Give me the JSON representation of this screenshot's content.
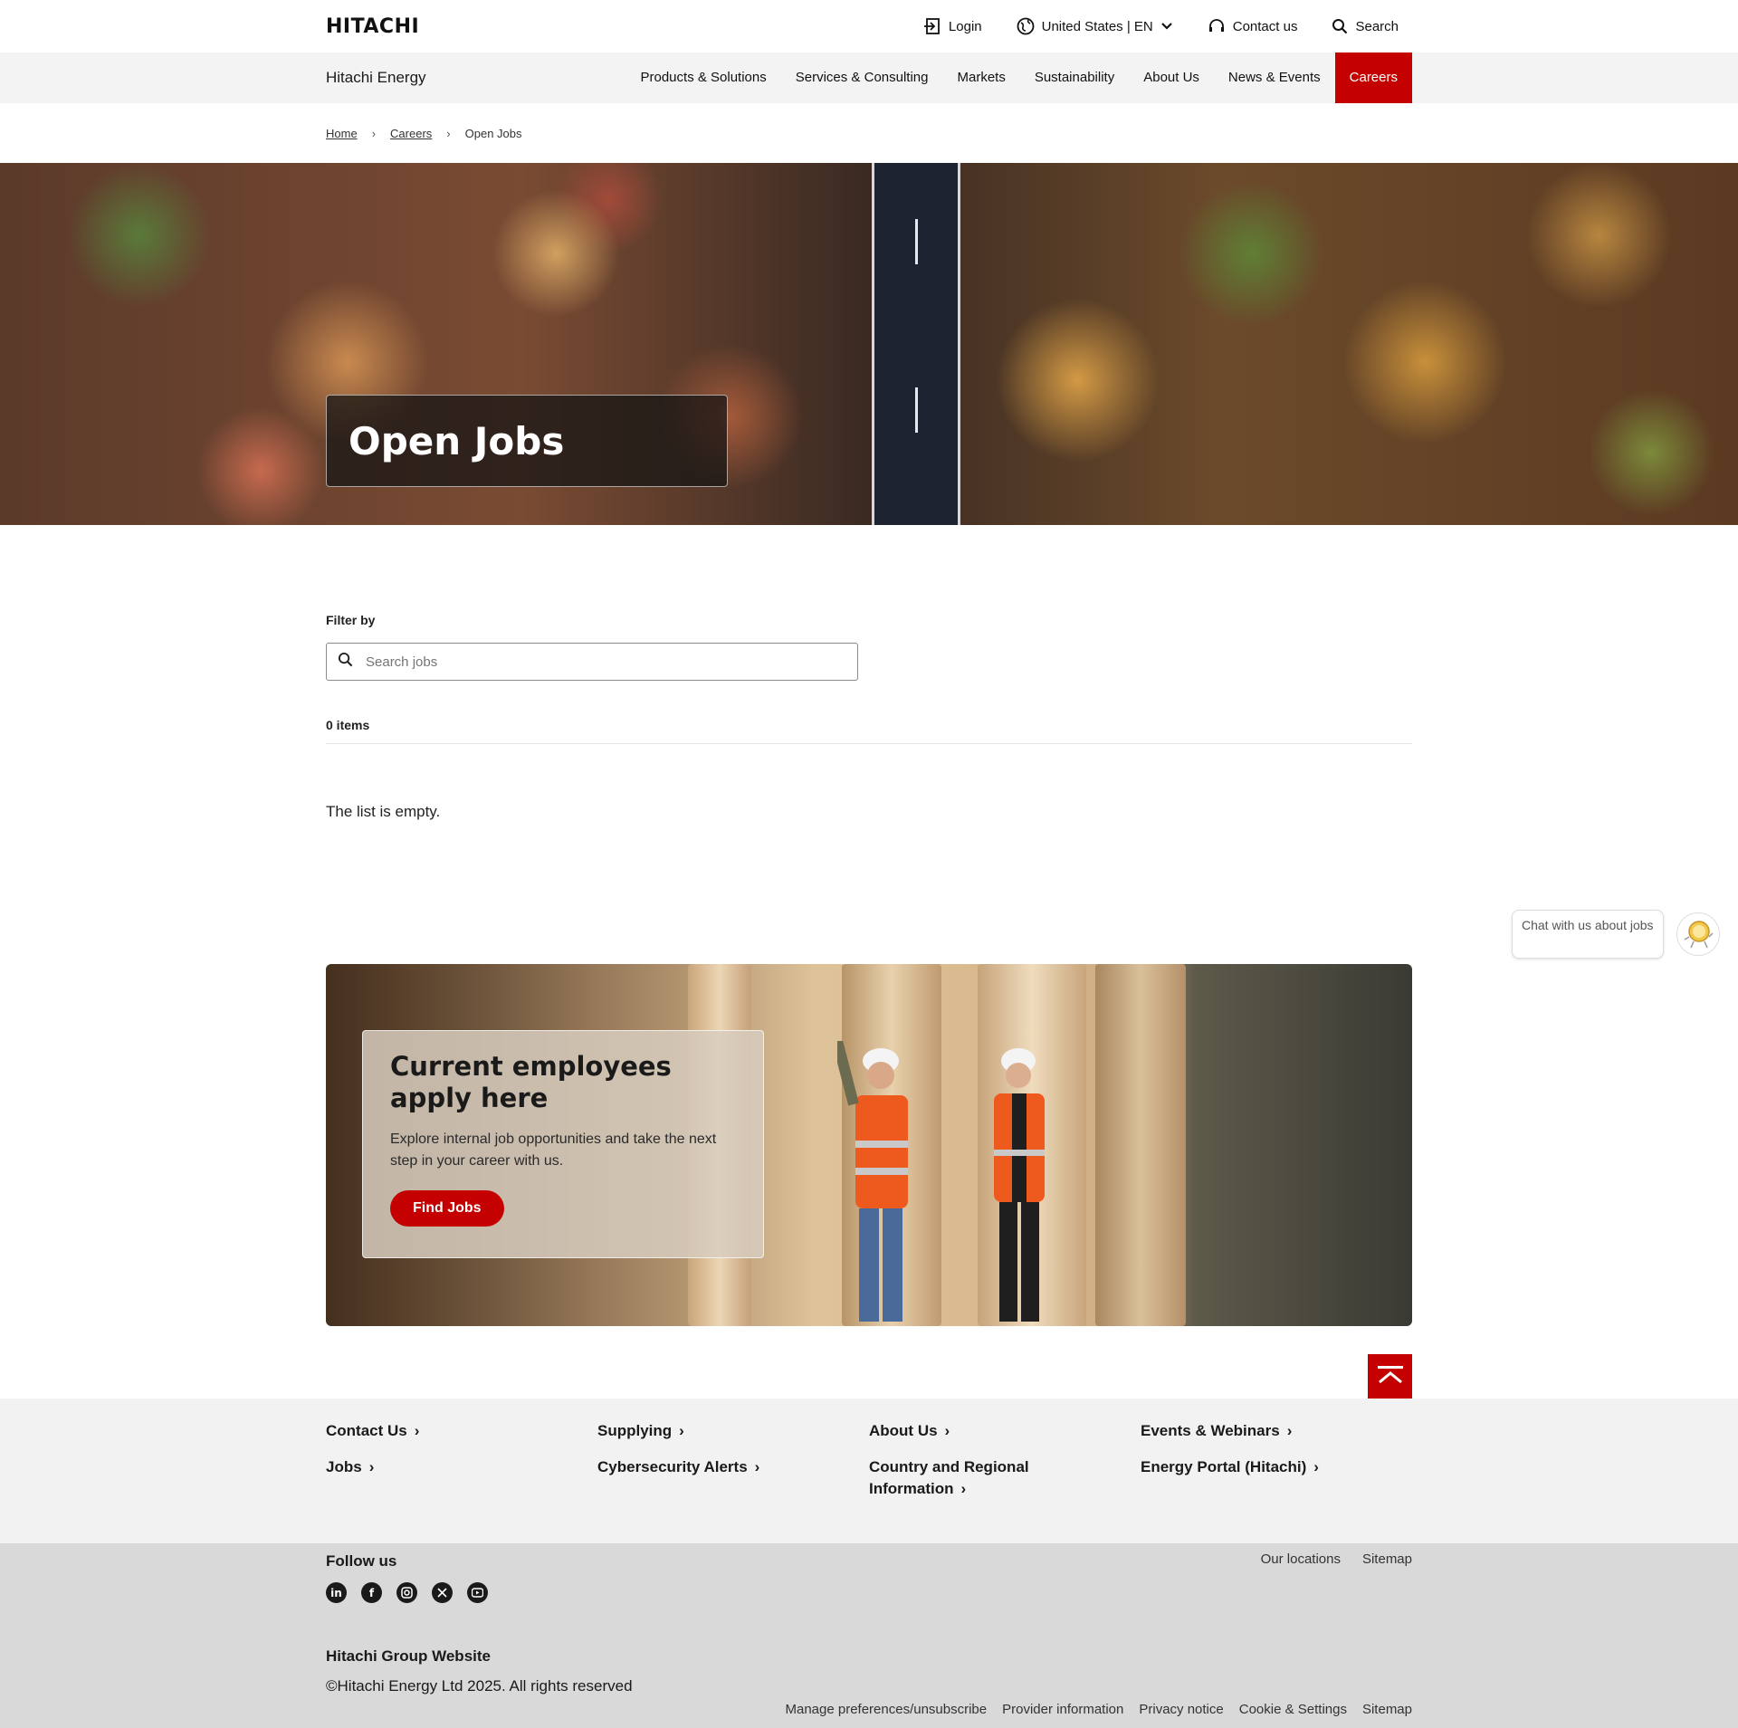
{
  "header": {
    "logo": "HITACHI",
    "login": "Login",
    "region": "United States | EN",
    "contact": "Contact us",
    "search": "Search"
  },
  "nav": {
    "brand": "Hitachi Energy",
    "items": [
      {
        "label": "Products & Solutions"
      },
      {
        "label": "Services & Consulting"
      },
      {
        "label": "Markets"
      },
      {
        "label": "Sustainability"
      },
      {
        "label": "About Us"
      },
      {
        "label": "News & Events"
      },
      {
        "label": "Careers"
      }
    ]
  },
  "breadcrumb": {
    "home": "Home",
    "careers": "Careers",
    "current": "Open Jobs"
  },
  "hero": {
    "title": "Open Jobs"
  },
  "filter": {
    "label": "Filter by",
    "search_placeholder": "Search jobs",
    "count": "0 items",
    "empty": "The list is empty."
  },
  "chat": {
    "text": "Chat with us about jobs"
  },
  "promo": {
    "title": "Current employees apply here",
    "text": "Explore internal job opportunities and take the next step in your career with us.",
    "button": "Find Jobs"
  },
  "footer_links": {
    "col1": [
      "Contact Us",
      "Jobs"
    ],
    "col2": [
      "Supplying",
      "Cybersecurity Alerts"
    ],
    "col3": [
      "About Us",
      "Country and Regional Information"
    ],
    "col4": [
      "Events & Webinars",
      "Energy Portal (Hitachi)"
    ]
  },
  "footer": {
    "follow": "Follow us",
    "socials": [
      "linkedin-icon",
      "facebook-icon",
      "instagram-icon",
      "x-icon",
      "youtube-icon"
    ],
    "our_locations": "Our locations",
    "sitemap": "Sitemap",
    "group_site": "Hitachi Group Website",
    "copyright": "©Hitachi Energy Ltd 2025. All rights reserved",
    "legal": [
      "Manage preferences/unsubscribe",
      "Provider information",
      "Privacy notice",
      "Cookie & Settings",
      "Sitemap"
    ]
  },
  "colors": {
    "accent": "#c40000",
    "nav_bg": "#f3f3f3",
    "footer_bg": "#f2f2f2",
    "footer_bottom_bg": "#d9d9d9"
  }
}
